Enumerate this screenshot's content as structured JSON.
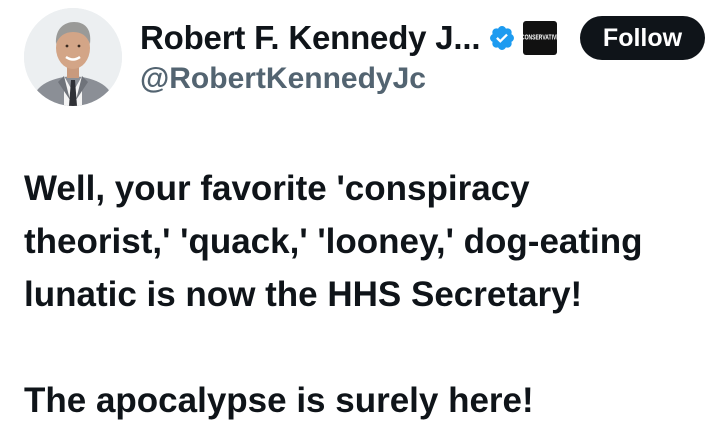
{
  "author": {
    "display_name": "Robert F. Kennedy J...",
    "handle": "@RobertKennedyJc",
    "avatar_icon": "profile-photo",
    "verified_icon": "verified-badge-icon",
    "verified_color": "#1d9bf0",
    "affiliation_badge_text": "CONSERVATIVE"
  },
  "actions": {
    "follow_label": "Follow"
  },
  "tweet": {
    "lines": [
      "Well, your favorite 'conspiracy",
      "theorist,' 'quack,' 'looney,' dog-eating",
      "lunatic is now the HHS Secretary!"
    ],
    "closing": "The apocalypse is surely here!"
  }
}
